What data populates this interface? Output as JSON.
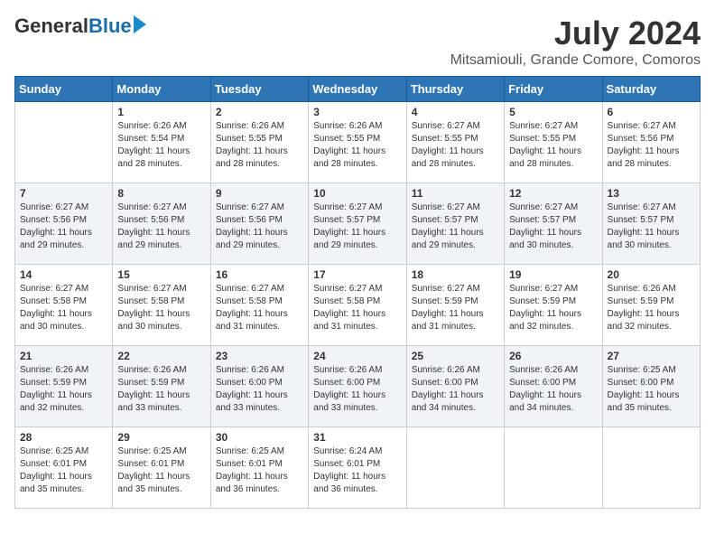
{
  "header": {
    "logo_general": "General",
    "logo_blue": "Blue",
    "month_year": "July 2024",
    "location": "Mitsamiouli, Grande Comore, Comoros"
  },
  "columns": [
    "Sunday",
    "Monday",
    "Tuesday",
    "Wednesday",
    "Thursday",
    "Friday",
    "Saturday"
  ],
  "weeks": [
    [
      {
        "day": "",
        "info": ""
      },
      {
        "day": "1",
        "info": "Sunrise: 6:26 AM\nSunset: 5:54 PM\nDaylight: 11 hours\nand 28 minutes."
      },
      {
        "day": "2",
        "info": "Sunrise: 6:26 AM\nSunset: 5:55 PM\nDaylight: 11 hours\nand 28 minutes."
      },
      {
        "day": "3",
        "info": "Sunrise: 6:26 AM\nSunset: 5:55 PM\nDaylight: 11 hours\nand 28 minutes."
      },
      {
        "day": "4",
        "info": "Sunrise: 6:27 AM\nSunset: 5:55 PM\nDaylight: 11 hours\nand 28 minutes."
      },
      {
        "day": "5",
        "info": "Sunrise: 6:27 AM\nSunset: 5:55 PM\nDaylight: 11 hours\nand 28 minutes."
      },
      {
        "day": "6",
        "info": "Sunrise: 6:27 AM\nSunset: 5:56 PM\nDaylight: 11 hours\nand 28 minutes."
      }
    ],
    [
      {
        "day": "7",
        "info": "Sunrise: 6:27 AM\nSunset: 5:56 PM\nDaylight: 11 hours\nand 29 minutes."
      },
      {
        "day": "8",
        "info": "Sunrise: 6:27 AM\nSunset: 5:56 PM\nDaylight: 11 hours\nand 29 minutes."
      },
      {
        "day": "9",
        "info": "Sunrise: 6:27 AM\nSunset: 5:56 PM\nDaylight: 11 hours\nand 29 minutes."
      },
      {
        "day": "10",
        "info": "Sunrise: 6:27 AM\nSunset: 5:57 PM\nDaylight: 11 hours\nand 29 minutes."
      },
      {
        "day": "11",
        "info": "Sunrise: 6:27 AM\nSunset: 5:57 PM\nDaylight: 11 hours\nand 29 minutes."
      },
      {
        "day": "12",
        "info": "Sunrise: 6:27 AM\nSunset: 5:57 PM\nDaylight: 11 hours\nand 30 minutes."
      },
      {
        "day": "13",
        "info": "Sunrise: 6:27 AM\nSunset: 5:57 PM\nDaylight: 11 hours\nand 30 minutes."
      }
    ],
    [
      {
        "day": "14",
        "info": "Sunrise: 6:27 AM\nSunset: 5:58 PM\nDaylight: 11 hours\nand 30 minutes."
      },
      {
        "day": "15",
        "info": "Sunrise: 6:27 AM\nSunset: 5:58 PM\nDaylight: 11 hours\nand 30 minutes."
      },
      {
        "day": "16",
        "info": "Sunrise: 6:27 AM\nSunset: 5:58 PM\nDaylight: 11 hours\nand 31 minutes."
      },
      {
        "day": "17",
        "info": "Sunrise: 6:27 AM\nSunset: 5:58 PM\nDaylight: 11 hours\nand 31 minutes."
      },
      {
        "day": "18",
        "info": "Sunrise: 6:27 AM\nSunset: 5:59 PM\nDaylight: 11 hours\nand 31 minutes."
      },
      {
        "day": "19",
        "info": "Sunrise: 6:27 AM\nSunset: 5:59 PM\nDaylight: 11 hours\nand 32 minutes."
      },
      {
        "day": "20",
        "info": "Sunrise: 6:26 AM\nSunset: 5:59 PM\nDaylight: 11 hours\nand 32 minutes."
      }
    ],
    [
      {
        "day": "21",
        "info": "Sunrise: 6:26 AM\nSunset: 5:59 PM\nDaylight: 11 hours\nand 32 minutes."
      },
      {
        "day": "22",
        "info": "Sunrise: 6:26 AM\nSunset: 5:59 PM\nDaylight: 11 hours\nand 33 minutes."
      },
      {
        "day": "23",
        "info": "Sunrise: 6:26 AM\nSunset: 6:00 PM\nDaylight: 11 hours\nand 33 minutes."
      },
      {
        "day": "24",
        "info": "Sunrise: 6:26 AM\nSunset: 6:00 PM\nDaylight: 11 hours\nand 33 minutes."
      },
      {
        "day": "25",
        "info": "Sunrise: 6:26 AM\nSunset: 6:00 PM\nDaylight: 11 hours\nand 34 minutes."
      },
      {
        "day": "26",
        "info": "Sunrise: 6:26 AM\nSunset: 6:00 PM\nDaylight: 11 hours\nand 34 minutes."
      },
      {
        "day": "27",
        "info": "Sunrise: 6:25 AM\nSunset: 6:00 PM\nDaylight: 11 hours\nand 35 minutes."
      }
    ],
    [
      {
        "day": "28",
        "info": "Sunrise: 6:25 AM\nSunset: 6:01 PM\nDaylight: 11 hours\nand 35 minutes."
      },
      {
        "day": "29",
        "info": "Sunrise: 6:25 AM\nSunset: 6:01 PM\nDaylight: 11 hours\nand 35 minutes."
      },
      {
        "day": "30",
        "info": "Sunrise: 6:25 AM\nSunset: 6:01 PM\nDaylight: 11 hours\nand 36 minutes."
      },
      {
        "day": "31",
        "info": "Sunrise: 6:24 AM\nSunset: 6:01 PM\nDaylight: 11 hours\nand 36 minutes."
      },
      {
        "day": "",
        "info": ""
      },
      {
        "day": "",
        "info": ""
      },
      {
        "day": "",
        "info": ""
      }
    ]
  ]
}
